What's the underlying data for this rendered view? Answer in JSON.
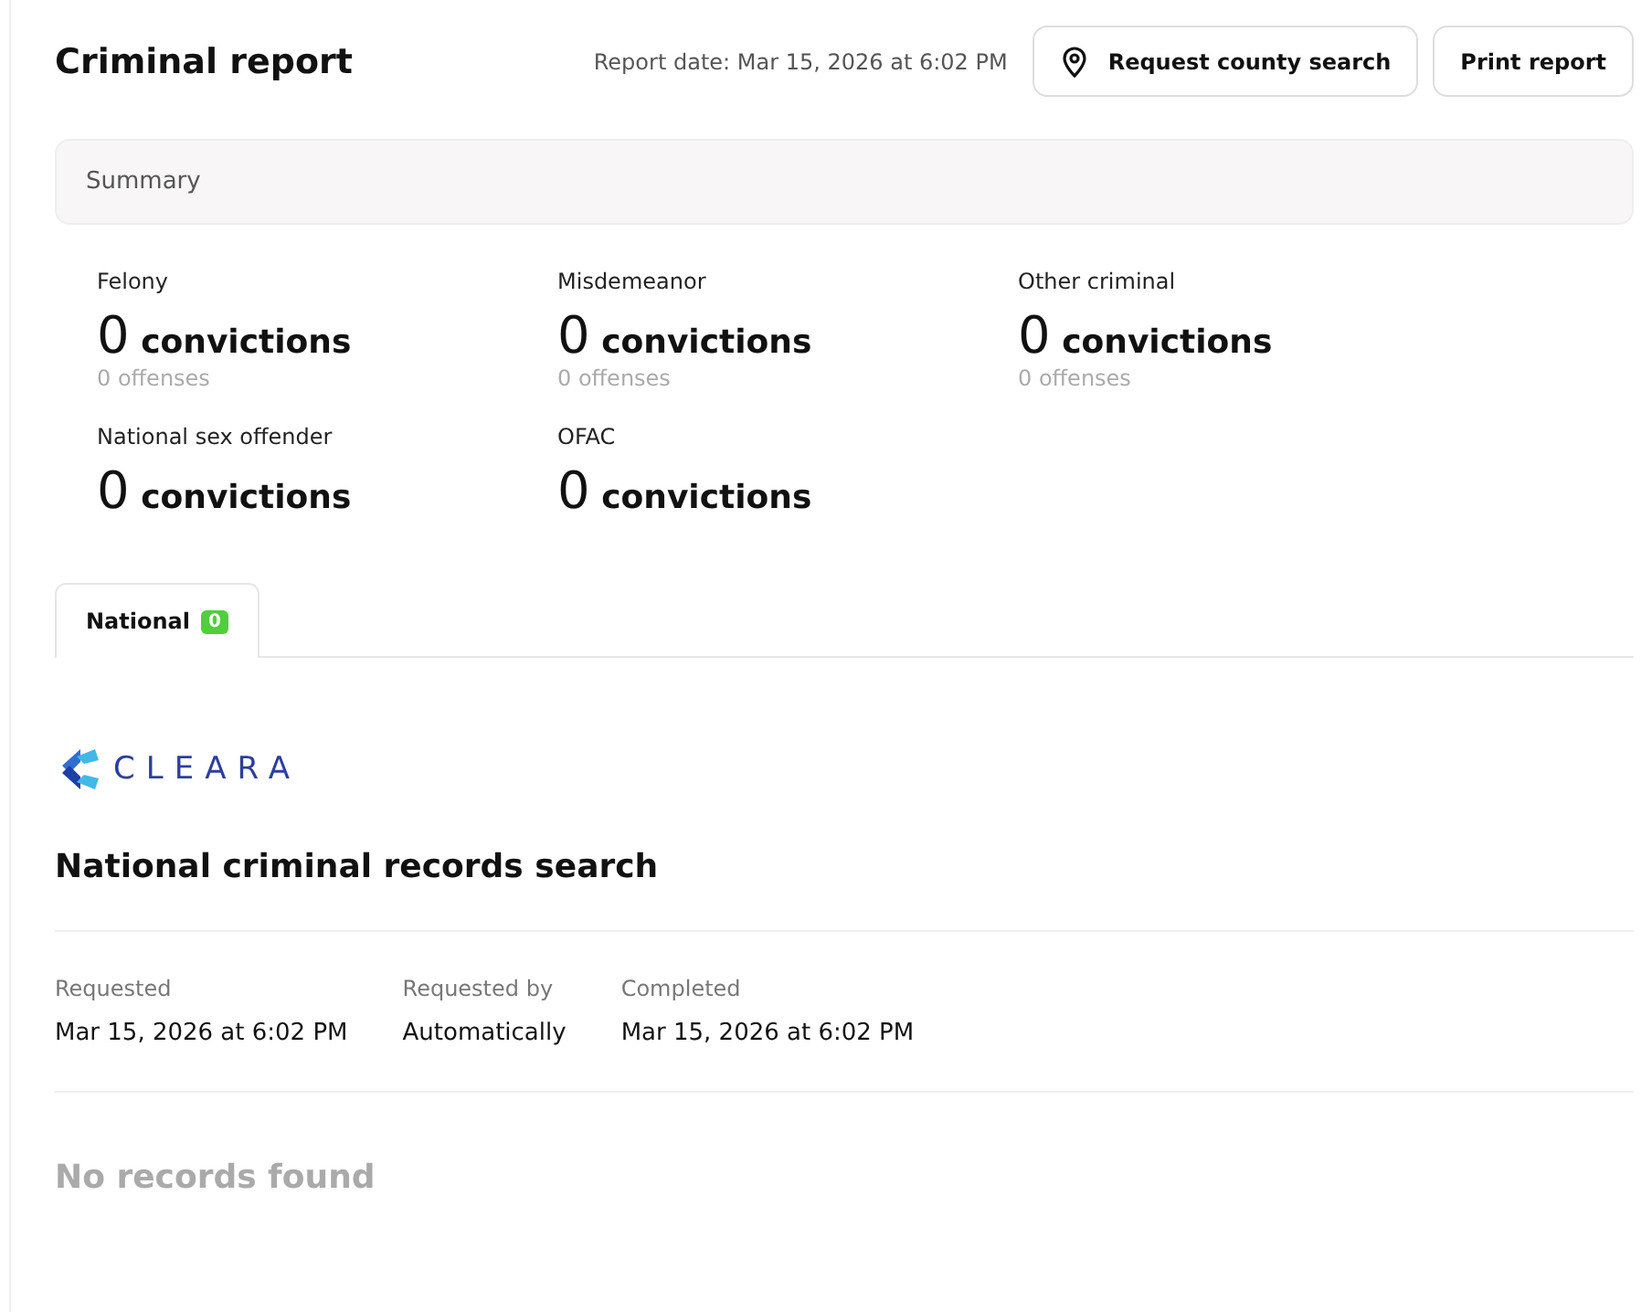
{
  "header": {
    "title": "Criminal report",
    "report_date": "Report date: Mar 15, 2026 at 6:02 PM",
    "buttons": [
      {
        "kind": "location",
        "label": "Request county search"
      },
      {
        "kind": "plain",
        "label": "Print report"
      }
    ]
  },
  "summary": {
    "label": "Summary",
    "stats": [
      {
        "label": "Felony",
        "count": "0",
        "unit": "convictions",
        "offenses": "0 offenses"
      },
      {
        "label": "Misdemeanor",
        "count": "0",
        "unit": "convictions",
        "offenses": "0 offenses"
      },
      {
        "label": "Other criminal",
        "count": "0",
        "unit": "convictions",
        "offenses": "0 offenses"
      },
      {
        "label": "National sex offender",
        "count": "0",
        "unit": "convictions"
      },
      {
        "label": "OFAC",
        "count": "0",
        "unit": "convictions"
      }
    ]
  },
  "tabs": [
    {
      "label": "National",
      "badge": "0",
      "selected": true
    }
  ],
  "search": {
    "provider": "CLEARA",
    "title": "National criminal records search",
    "details": [
      {
        "label": "Requested",
        "value": "Mar 15, 2026 at 6:02 PM"
      },
      {
        "label": "Requested by",
        "value": "Automatically"
      },
      {
        "label": "Completed",
        "value": "Mar 15, 2026 at 6:02 PM"
      }
    ],
    "result": "No records found"
  }
}
